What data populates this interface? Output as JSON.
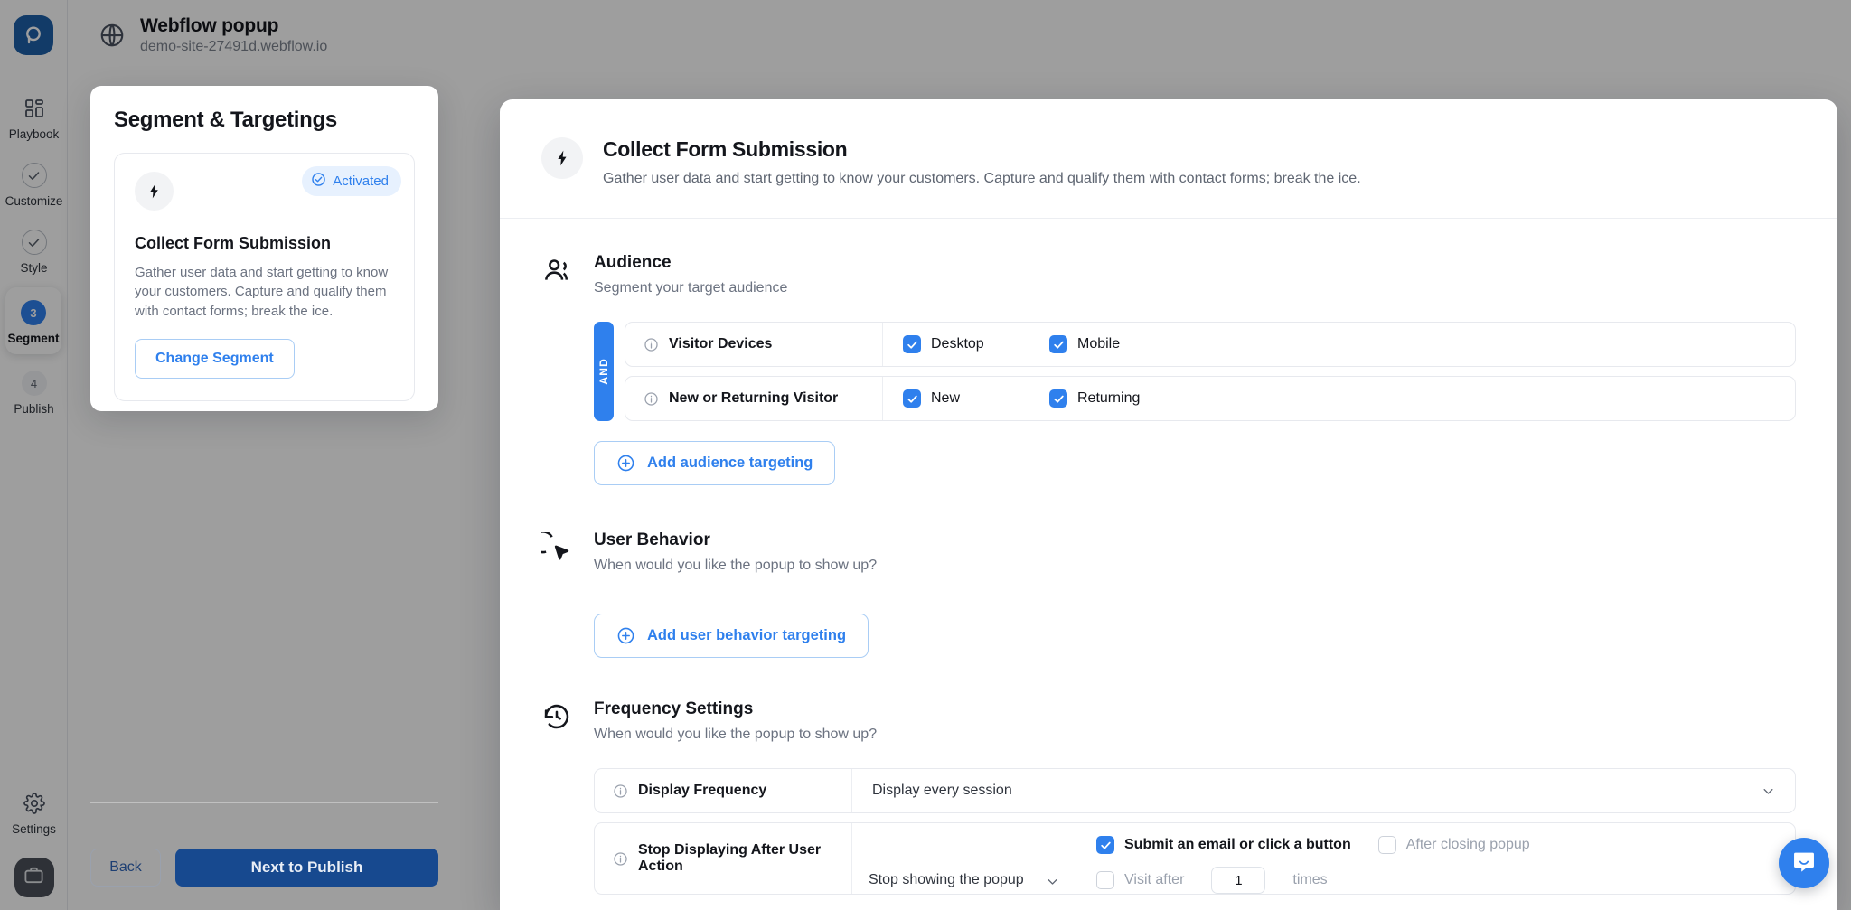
{
  "topbar": {
    "logo_icon": "popupsmart-logo",
    "globe_icon": "globe-icon",
    "site_title": "Webflow popup",
    "site_url": "demo-site-27491d.webflow.io"
  },
  "rail": {
    "items": [
      {
        "label": "Playbook",
        "icon": "grid-icon",
        "state": "icon",
        "badge": ""
      },
      {
        "label": "Customize",
        "icon": "check-circle-icon",
        "state": "done",
        "badge": ""
      },
      {
        "label": "Style",
        "icon": "check-circle-icon",
        "state": "done",
        "badge": ""
      },
      {
        "label": "Segment",
        "icon": "step-number",
        "state": "active",
        "badge": "3"
      },
      {
        "label": "Publish",
        "icon": "step-number",
        "state": "todo",
        "badge": "4"
      }
    ],
    "settings_label": "Settings",
    "settings_icon": "gear-icon",
    "workspace_icon": "briefcase-icon"
  },
  "side_panel": {
    "title": "Segment & Targetings",
    "badge": {
      "label": "Activated",
      "icon": "check-circle-icon",
      "color": "#2f80ed"
    },
    "card_icon": "bolt-icon",
    "card_title": "Collect Form Submission",
    "card_desc": "Gather user data and start getting to know your customers. Capture and qualify them with contact forms; break the ice.",
    "change_segment_label": "Change Segment"
  },
  "footer": {
    "back_label": "Back",
    "next_label": "Next to Publish"
  },
  "sheet": {
    "header": {
      "icon": "bolt-icon",
      "title": "Collect Form Submission",
      "subtitle": "Gather user data and start getting to know your customers. Capture and qualify them with contact forms; break the ice."
    },
    "audience": {
      "icon": "people-icon",
      "title": "Audience",
      "subtitle": "Segment your target audience",
      "operator": "AND",
      "rules": [
        {
          "name": "Visitor Devices",
          "info_icon": "info-icon",
          "options": [
            {
              "label": "Desktop",
              "checked": true
            },
            {
              "label": "Mobile",
              "checked": true
            }
          ]
        },
        {
          "name": "New or Returning Visitor",
          "info_icon": "info-icon",
          "options": [
            {
              "label": "New",
              "checked": true
            },
            {
              "label": "Returning",
              "checked": true
            }
          ]
        }
      ],
      "add_label": "Add audience targeting",
      "add_icon": "plus-circle-icon"
    },
    "user_behavior": {
      "icon": "cursor-click-icon",
      "title": "User Behavior",
      "subtitle": "When would you like the popup to show up?",
      "add_label": "Add user behavior targeting",
      "add_icon": "plus-circle-icon"
    },
    "frequency": {
      "icon": "history-icon",
      "title": "Frequency Settings",
      "subtitle": "When would you like the popup to show up?",
      "rows": [
        {
          "name": "Display Frequency",
          "info_icon": "info-icon",
          "value": "Display every session",
          "chevron_icon": "chevron-down-icon"
        }
      ],
      "action_row": {
        "name": "Stop Displaying After User Action",
        "info_icon": "info-icon",
        "select_value": "Stop showing the popup",
        "chevron_icon": "chevron-down-icon",
        "checks": [
          {
            "label": "Submit an email or click a button",
            "checked": true
          },
          {
            "label": "After closing popup",
            "checked": false
          }
        ],
        "visit_after_label": "Visit after",
        "visit_after_value": "1",
        "times_label": "times",
        "visit_after_checked": false
      }
    }
  },
  "chat": {
    "icon": "chat-bubble-icon"
  }
}
